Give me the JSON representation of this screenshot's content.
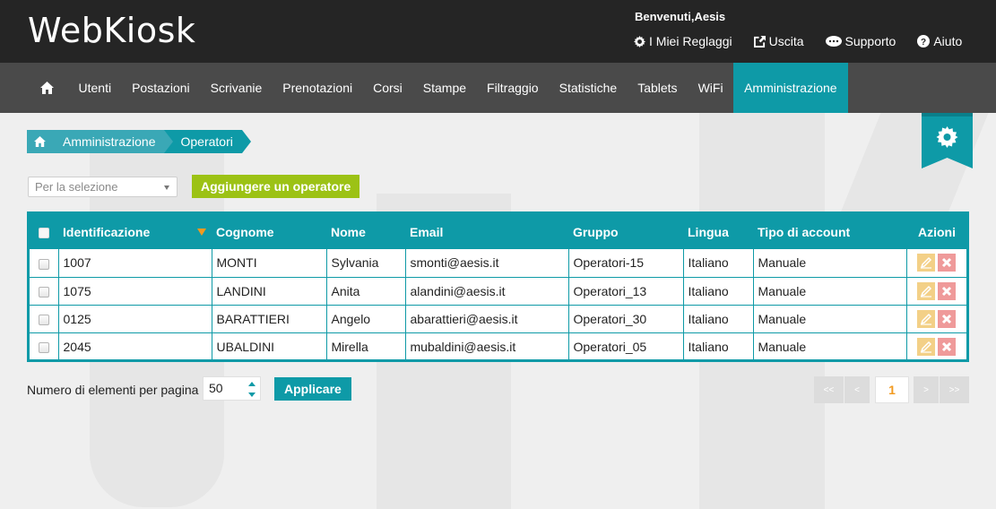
{
  "app": {
    "logo": "WebKiosk"
  },
  "header": {
    "welcome": "Benvenuti,Aesis",
    "links": [
      {
        "label": "I Miei Reglaggi",
        "icon": "gear-icon"
      },
      {
        "label": "Uscita",
        "icon": "exit-icon"
      },
      {
        "label": "Supporto",
        "icon": "chat-icon"
      },
      {
        "label": "Aiuto",
        "icon": "help-icon"
      }
    ]
  },
  "nav": {
    "home_icon": "home-icon",
    "items": [
      "Utenti",
      "Postazioni",
      "Scrivanie",
      "Prenotazioni",
      "Corsi",
      "Stampe",
      "Filtraggio",
      "Statistiche",
      "Tablets",
      "WiFi",
      "Amministrazione"
    ],
    "active": "Amministrazione"
  },
  "breadcrumb": [
    "Amministrazione",
    "Operatori"
  ],
  "controls": {
    "select_value": "Per la selezione",
    "add_button": "Aggiungere un operatore"
  },
  "table": {
    "columns": [
      "Identificazione",
      "Cognome",
      "Nome",
      "Email",
      "Gruppo",
      "Lingua",
      "Tipo di account",
      "Azioni"
    ],
    "rows": [
      [
        "1007",
        "MONTI",
        "Sylvania",
        "smonti@aesis.it",
        "Operatori-15",
        "Italiano",
        "Manuale"
      ],
      [
        "1075",
        "LANDINI",
        "Anita",
        "alandini@aesis.it",
        "Operatori_13",
        "Italiano",
        "Manuale"
      ],
      [
        "0125",
        "BARATTIERI",
        "Angelo",
        "abarattieri@aesis.it",
        "Operatori_30",
        "Italiano",
        "Manuale"
      ],
      [
        "2045",
        "UBALDINI",
        "Mirella",
        "mubaldini@aesis.it",
        "Operatori_05",
        "Italiano",
        "Manuale"
      ]
    ]
  },
  "pagination": {
    "per_page_label": "Numero di elementi per pagina",
    "per_page_value": "50",
    "apply_button": "Applicare",
    "first": "<<",
    "prev": "<",
    "current_page": "1",
    "next": ">",
    "last": ">>"
  },
  "colors": {
    "accent": "#0e9aa7",
    "add_button": "#9cc215",
    "nav_bg": "#4a4a4a",
    "header_bg": "#252525",
    "sort_arrow": "#f29a1f"
  }
}
